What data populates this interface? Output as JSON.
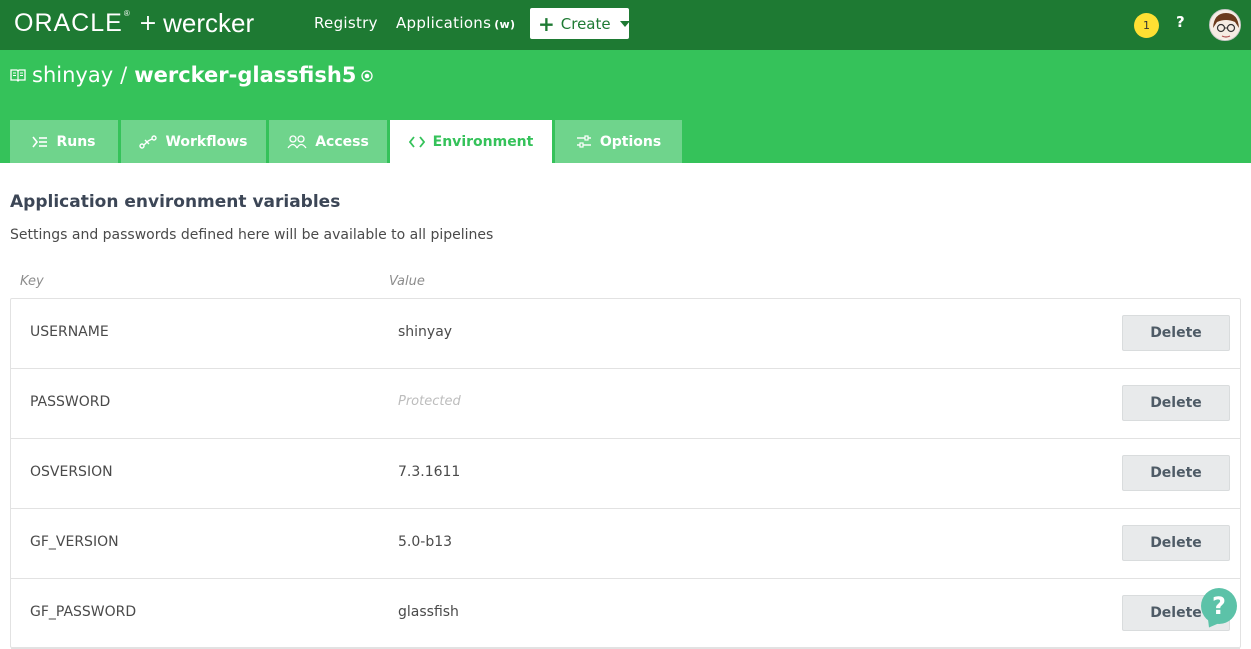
{
  "navbar": {
    "brand_oracle": "ORACLE",
    "brand_plus": "+",
    "brand_wercker": "wercker",
    "registry_label": "Registry",
    "applications_label": "Applications",
    "applications_suffix": "(w)",
    "create_label": "Create",
    "notification_count": "1",
    "help_label": "?",
    "bg_color": "#1e7a33"
  },
  "header": {
    "owner": "shinyay",
    "separator": "/",
    "repo": "wercker-glassfish5",
    "bg_color": "#35c25a"
  },
  "tabs": [
    {
      "label": "Runs",
      "icon": "runs-icon",
      "active": false
    },
    {
      "label": "Workflows",
      "icon": "workflows-icon",
      "active": false
    },
    {
      "label": "Access",
      "icon": "access-icon",
      "active": false
    },
    {
      "label": "Environment",
      "icon": "code-brackets-icon",
      "active": true
    },
    {
      "label": "Options",
      "icon": "options-icon",
      "active": false
    }
  ],
  "main": {
    "title": "Application environment variables",
    "description": "Settings and passwords defined here will be available to all pipelines",
    "col_key": "Key",
    "col_value": "Value",
    "delete_label": "Delete",
    "rows": [
      {
        "key": "USERNAME",
        "value": "shinyay",
        "protected": false
      },
      {
        "key": "PASSWORD",
        "value": "Protected",
        "protected": true
      },
      {
        "key": "OSVERSION",
        "value": "7.3.1611",
        "protected": false
      },
      {
        "key": "GF_VERSION",
        "value": "5.0-b13",
        "protected": false
      },
      {
        "key": "GF_PASSWORD",
        "value": "glassfish",
        "protected": false
      }
    ]
  },
  "support": {
    "label": "?",
    "color": "#5cc2a8"
  }
}
